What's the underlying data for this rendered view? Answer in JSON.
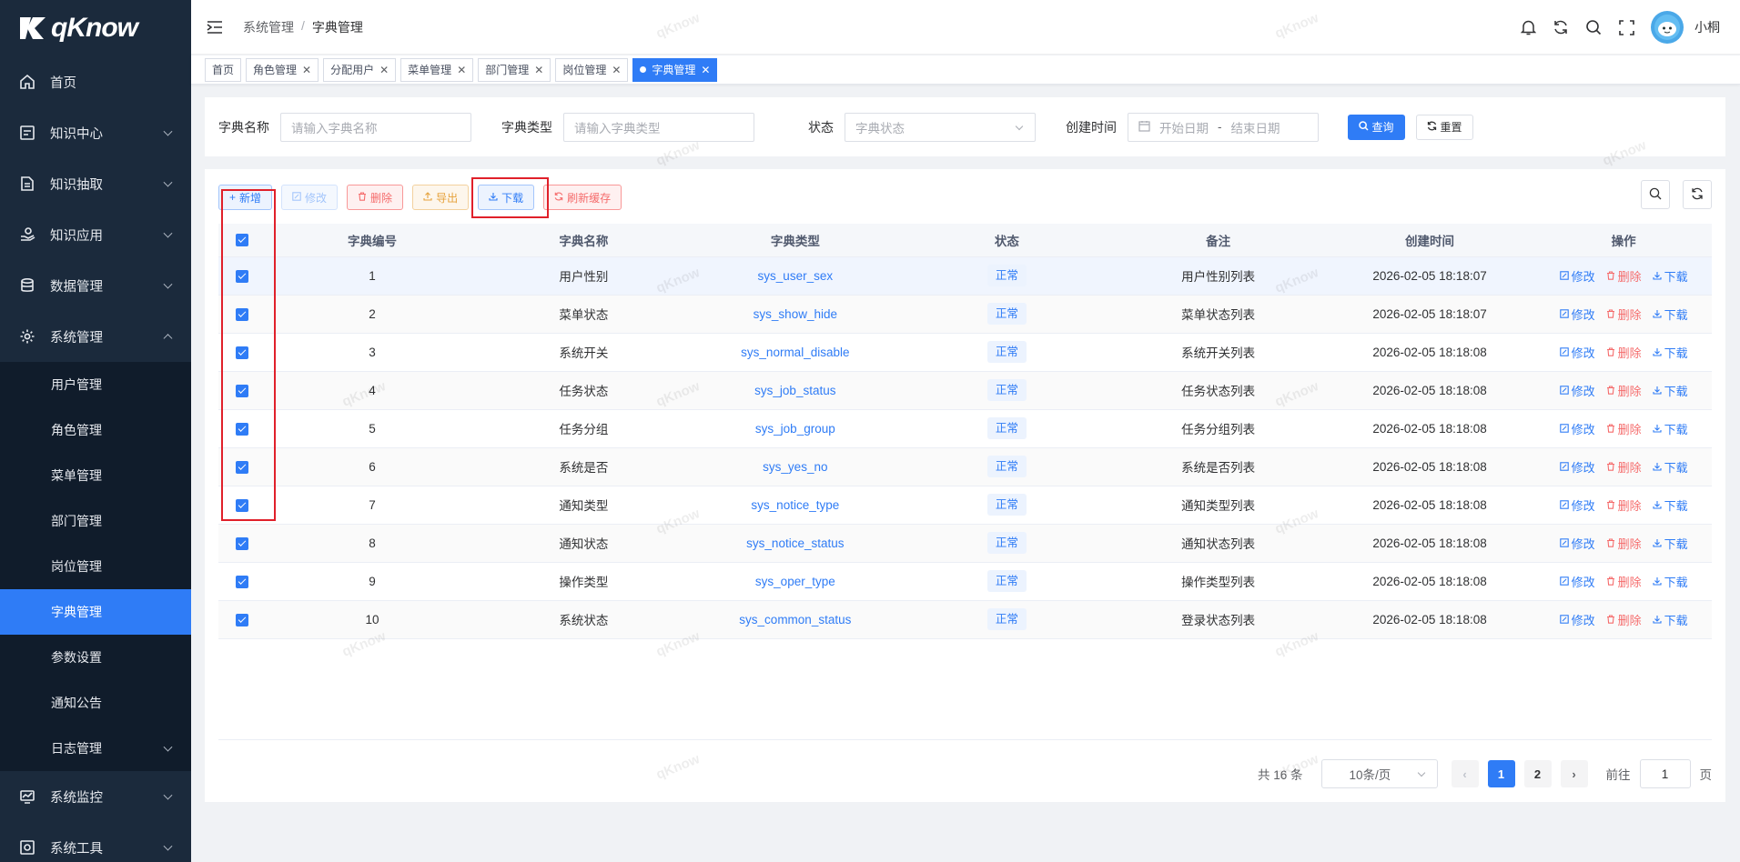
{
  "app": {
    "logo_text": "qKnow"
  },
  "sidebar": {
    "items": [
      {
        "label": "首页",
        "icon": "home-icon"
      },
      {
        "label": "知识中心",
        "icon": "document-icon"
      },
      {
        "label": "知识抽取",
        "icon": "file-icon"
      },
      {
        "label": "知识应用",
        "icon": "hand-icon"
      },
      {
        "label": "数据管理",
        "icon": "database-icon"
      },
      {
        "label": "系统管理",
        "icon": "gear-icon"
      },
      {
        "label": "系统监控",
        "icon": "monitor-icon"
      },
      {
        "label": "系统工具",
        "icon": "tool-icon"
      }
    ],
    "sub_items": [
      {
        "label": "用户管理"
      },
      {
        "label": "角色管理"
      },
      {
        "label": "菜单管理"
      },
      {
        "label": "部门管理"
      },
      {
        "label": "岗位管理"
      },
      {
        "label": "字典管理",
        "active": true
      },
      {
        "label": "参数设置"
      },
      {
        "label": "通知公告"
      },
      {
        "label": "日志管理"
      }
    ]
  },
  "header": {
    "breadcrumb": [
      "系统管理",
      "字典管理"
    ],
    "breadcrumb_sep": "/",
    "username": "小桐"
  },
  "tags": [
    "首页",
    "角色管理",
    "分配用户",
    "菜单管理",
    "部门管理",
    "岗位管理",
    "字典管理"
  ],
  "search": {
    "name_label": "字典名称",
    "name_placeholder": "请输入字典名称",
    "type_label": "字典类型",
    "type_placeholder": "请输入字典类型",
    "status_label": "状态",
    "status_placeholder": "字典状态",
    "time_label": "创建时间",
    "start_placeholder": "开始日期",
    "range_sep": "-",
    "end_placeholder": "结束日期",
    "query_label": "查询",
    "reset_label": "重置"
  },
  "toolbar": {
    "add": "新增",
    "edit": "修改",
    "delete": "删除",
    "export": "导出",
    "download": "下载",
    "refresh_cache": "刷新缓存"
  },
  "table": {
    "columns": [
      "字典编号",
      "字典名称",
      "字典类型",
      "状态",
      "备注",
      "创建时间",
      "操作"
    ],
    "rows": [
      {
        "id": "1",
        "name": "用户性别",
        "type": "sys_user_sex",
        "status": "正常",
        "remark": "用户性别列表",
        "created": "2026-02-05 18:18:07"
      },
      {
        "id": "2",
        "name": "菜单状态",
        "type": "sys_show_hide",
        "status": "正常",
        "remark": "菜单状态列表",
        "created": "2026-02-05 18:18:07"
      },
      {
        "id": "3",
        "name": "系统开关",
        "type": "sys_normal_disable",
        "status": "正常",
        "remark": "系统开关列表",
        "created": "2026-02-05 18:18:08"
      },
      {
        "id": "4",
        "name": "任务状态",
        "type": "sys_job_status",
        "status": "正常",
        "remark": "任务状态列表",
        "created": "2026-02-05 18:18:08"
      },
      {
        "id": "5",
        "name": "任务分组",
        "type": "sys_job_group",
        "status": "正常",
        "remark": "任务分组列表",
        "created": "2026-02-05 18:18:08"
      },
      {
        "id": "6",
        "name": "系统是否",
        "type": "sys_yes_no",
        "status": "正常",
        "remark": "系统是否列表",
        "created": "2026-02-05 18:18:08"
      },
      {
        "id": "7",
        "name": "通知类型",
        "type": "sys_notice_type",
        "status": "正常",
        "remark": "通知类型列表",
        "created": "2026-02-05 18:18:08"
      },
      {
        "id": "8",
        "name": "通知状态",
        "type": "sys_notice_status",
        "status": "正常",
        "remark": "通知状态列表",
        "created": "2026-02-05 18:18:08"
      },
      {
        "id": "9",
        "name": "操作类型",
        "type": "sys_oper_type",
        "status": "正常",
        "remark": "操作类型列表",
        "created": "2026-02-05 18:18:08"
      },
      {
        "id": "10",
        "name": "系统状态",
        "type": "sys_common_status",
        "status": "正常",
        "remark": "登录状态列表",
        "created": "2026-02-05 18:18:08"
      }
    ],
    "row_actions": {
      "edit": "修改",
      "delete": "删除",
      "download": "下载"
    }
  },
  "pagination": {
    "total": "共 16 条",
    "page_size": "10条/页",
    "pages": [
      "1",
      "2"
    ],
    "current": "1",
    "goto_label": "前往",
    "goto_value": "1",
    "page_suffix": "页"
  },
  "watermark": "qKnow",
  "colors": {
    "primary": "#2f7cf6",
    "sidebar_bg": "#1b2a3c",
    "danger": "#f56c6c",
    "warning": "#e6a23c",
    "highlight_box": "#e0202a"
  }
}
